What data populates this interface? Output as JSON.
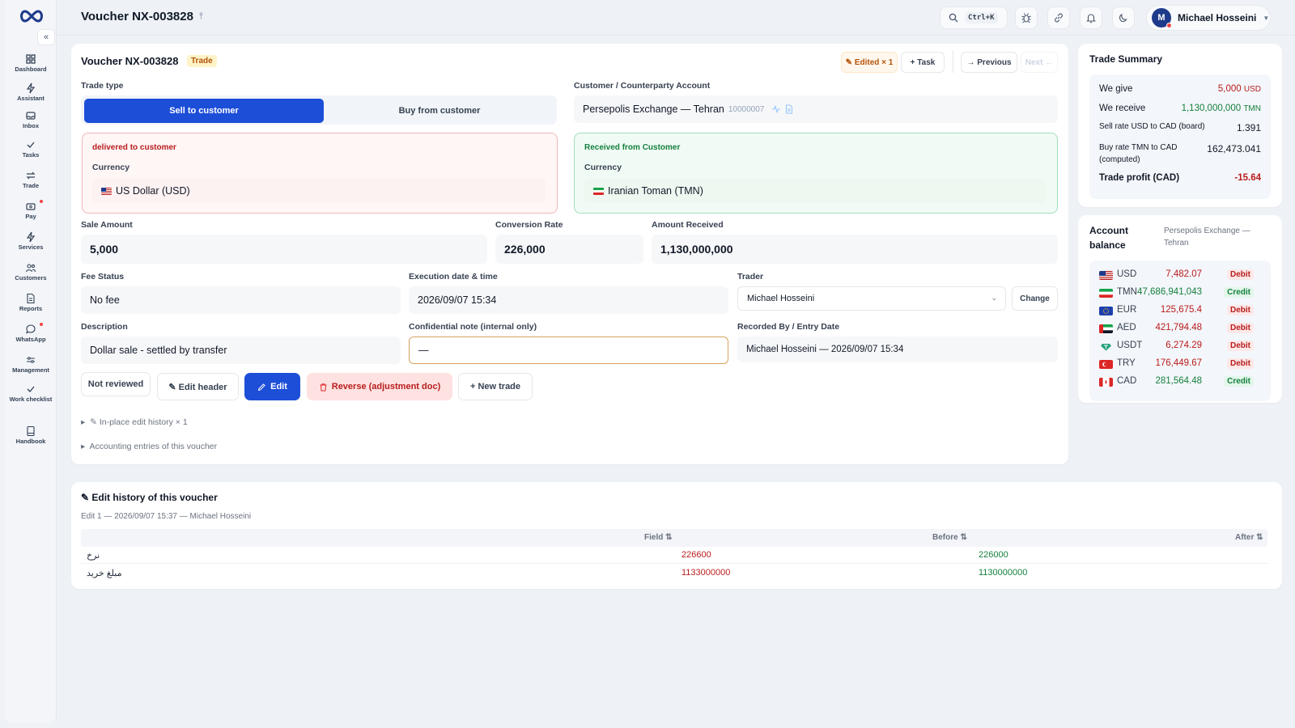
{
  "topbar": {
    "title": "Voucher NX-003828",
    "pin_glyph": "⫯",
    "search_shortcut": "Ctrl+K",
    "user_initial": "M",
    "user_name": "Michael Hosseini"
  },
  "sidebar": {
    "collapse_glyph": "«",
    "items": [
      {
        "label": "Dashboard"
      },
      {
        "label": "Assistant"
      },
      {
        "label": "Inbox"
      },
      {
        "label": "Tasks"
      },
      {
        "label": "Trade"
      },
      {
        "label": "Pay"
      },
      {
        "label": "Services"
      },
      {
        "label": "Customers"
      },
      {
        "label": "Reports"
      },
      {
        "label": "WhatsApp"
      },
      {
        "label": "Management"
      },
      {
        "label": "Work checklist"
      },
      {
        "label": "Handbook"
      }
    ]
  },
  "voucher": {
    "title": "Voucher NX-003828",
    "type_badge": "Trade",
    "edited_label": "✎ Edited × 1",
    "task_label": "+ Task",
    "prev_label": "→ Previous",
    "next_label": "Next ←",
    "trade_type_label": "Trade type",
    "sell_label": "Sell to customer",
    "buy_label": "Buy from customer",
    "customer_label": "Customer / Counterparty Account",
    "customer_name": "Persepolis Exchange — Tehran",
    "customer_code": "10000007",
    "delivered_title": "delivered to customer",
    "delivered_currency_label": "Currency",
    "delivered_currency": "US Dollar (USD)",
    "received_title": "Received from Customer",
    "received_currency_label": "Currency",
    "received_currency": "Iranian Toman (TMN)",
    "sale_amount_label": "Sale Amount",
    "sale_amount": "5,000",
    "rate_label": "Conversion Rate",
    "rate": "226,000",
    "received_amount_label": "Amount Received",
    "received_amount": "1,130,000,000",
    "fee_label": "Fee Status",
    "fee_value": "No fee",
    "exec_label": "Execution date & time",
    "exec_value": "2026/09/07 15:34",
    "trader_label": "Trader",
    "trader_value": "Michael Hosseini",
    "change_label": "Change",
    "desc_label": "Description",
    "desc_value": "Dollar sale - settled by transfer",
    "note_label": "Confidential note (internal only)",
    "note_value": "—",
    "recorded_label": "Recorded By / Entry Date",
    "recorded_value": "Michael Hosseini — 2026/09/07 15:34",
    "not_reviewed_label": "Not reviewed",
    "edit_header_label": "✎ Edit header",
    "edit_label": "Edit",
    "reverse_label": "Reverse (adjustment doc)",
    "new_trade_label": "+ New trade",
    "inplace_history_label": "✎ In-place edit history × 1",
    "accounting_label": "Accounting entries of this voucher"
  },
  "summary": {
    "title": "Trade Summary",
    "give_label": "We give",
    "give_value": "5,000",
    "give_unit": "USD",
    "receive_label": "We receive",
    "receive_value": "1,130,000,000",
    "receive_unit": "TMN",
    "sell_rate_label": "Sell rate USD to CAD (board)",
    "sell_rate_value": "1.391",
    "buy_rate_label_1": "Buy rate TMN to CAD",
    "buy_rate_label_2": "(computed)",
    "buy_rate_value": "162,473.041",
    "profit_label": "Trade profit (CAD)",
    "profit_value": "-15.64"
  },
  "balance": {
    "title_1": "Account",
    "title_2": "balance",
    "account_1": "Persepolis Exchange —",
    "account_2": "Tehran",
    "rows": [
      {
        "cur": "USD",
        "amt": "7,482.07",
        "status": "Debit"
      },
      {
        "cur": "TMN",
        "amt": "47,686,941,043",
        "status": "Credit"
      },
      {
        "cur": "EUR",
        "amt": "125,675.4",
        "status": "Debit"
      },
      {
        "cur": "AED",
        "amt": "421,794.48",
        "status": "Debit"
      },
      {
        "cur": "USDT",
        "amt": "6,274.29",
        "status": "Debit"
      },
      {
        "cur": "TRY",
        "amt": "176,449.67",
        "status": "Debit"
      },
      {
        "cur": "CAD",
        "amt": "281,564.48",
        "status": "Credit"
      }
    ]
  },
  "history": {
    "title": "✎ Edit history of this voucher",
    "meta": "Edit 1 — 2026/09/07 15:37 — Michael Hosseini",
    "col_field": "Field ⇅",
    "col_before": "Before ⇅",
    "col_after": "After ⇅",
    "rows": [
      {
        "field": "نرخ",
        "before": "226600",
        "after": "226000"
      },
      {
        "field": "مبلغ خرید",
        "before": "1133000000",
        "after": "1130000000"
      }
    ]
  }
}
